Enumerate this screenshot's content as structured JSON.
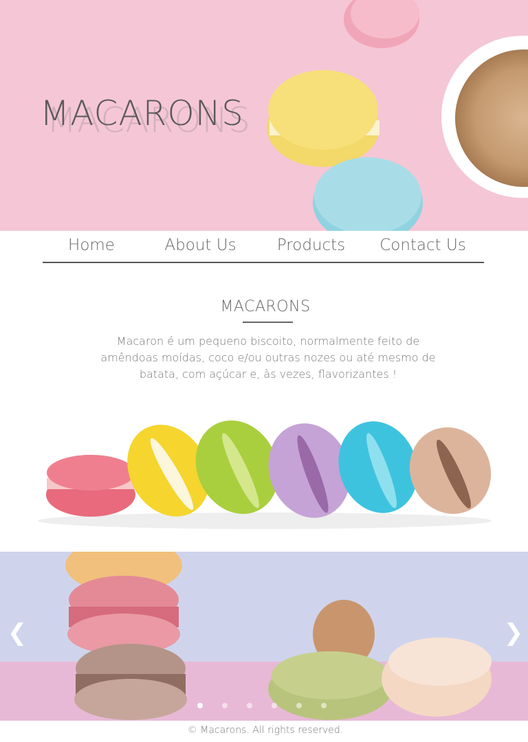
{
  "hero": {
    "title": "MACARONS",
    "colors": {
      "background": "#f5c6d6"
    }
  },
  "nav": {
    "items": [
      {
        "label": "Home"
      },
      {
        "label": "About Us"
      },
      {
        "label": "Products"
      },
      {
        "label": "Contact Us"
      }
    ]
  },
  "intro": {
    "title": "MACARONS",
    "text": "Macaron é um pequeno biscoito, normalmente feito de amêndoas moídas, coco e/ou outras nozes ou até mesmo de batata, com açúcar e, às vezes, flavorizantes !"
  },
  "carousel": {
    "prev_icon": "❮",
    "next_icon": "❯",
    "slide_count": 6,
    "active_index": 0
  },
  "footer": {
    "text": "© Macarons. All rights reserved."
  }
}
